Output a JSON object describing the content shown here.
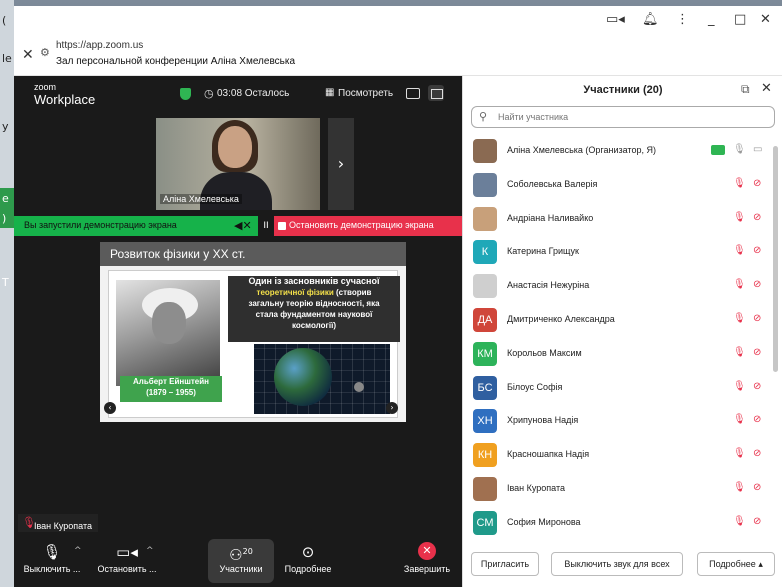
{
  "desktop": {
    "left_glyphs": [
      "(",
      "le",
      "y",
      "e",
      ")",
      "T"
    ]
  },
  "window": {
    "titlebar_icons": [
      "camera-icon",
      "bell-icon",
      "kebab-icon",
      "minimize-icon",
      "maximize-icon",
      "close-icon"
    ],
    "url": "https://app.zoom.us",
    "page_title": "Зал персональной конференции Аліна Хмелевська"
  },
  "meeting": {
    "logo_top": "zoom",
    "logo_bottom": "Workplace",
    "time_left": "03:08 Осталось",
    "view_label": "Посмотреть",
    "camera_name": "Аліна Хмелевська",
    "sharing_notice": "Вы запустили демонстрацию экрана",
    "stop_share_label": "Остановить демонстрацию экрана",
    "pause_label": "II",
    "slide": {
      "title": "Розвиток фізики у ХХ ст.",
      "fact_line1": "Один із засновників сучасної",
      "fact_highlight": "теоретичної фізики",
      "fact_line2_rest": " (створив",
      "fact_line3": "загальну теорію відносності, яка",
      "fact_line4": "стала фундаментом наукової",
      "fact_line5": "космології)",
      "caption_name": "Альберт Ейнштейн",
      "caption_years": "(1879 – 1955)"
    },
    "speaker_label": "Іван Куропата",
    "toolbar": {
      "mute_label": "Выключить ...",
      "video_label": "Остановить ...",
      "participants_label": "Участники",
      "participants_count": "20",
      "more_label": "Подробнее",
      "end_label": "Завершить"
    }
  },
  "panel": {
    "title": "Участники (20)",
    "search_placeholder": "Найти участника",
    "participants": [
      {
        "name": "Аліна Хмелевська (Организатор, Я)",
        "initials": "",
        "color": "#8a6a52",
        "host": true
      },
      {
        "name": "Соболевська Валерія",
        "initials": "",
        "color": "#6b7f9a"
      },
      {
        "name": "Андріана Наливайко",
        "initials": "",
        "color": "#c8a07a"
      },
      {
        "name": "Катерина Грищук",
        "initials": "К",
        "color": "#1fa8b8"
      },
      {
        "name": "Анастасія Нежуріна",
        "initials": "",
        "color": "#cfcfcf"
      },
      {
        "name": "Дмитриченко Александра",
        "initials": "ДА",
        "color": "#d0463a"
      },
      {
        "name": "Корольов Максим",
        "initials": "КМ",
        "color": "#2db35a"
      },
      {
        "name": "Білоус Софія",
        "initials": "БС",
        "color": "#2f5fa0"
      },
      {
        "name": "Хрипунова Надія",
        "initials": "ХН",
        "color": "#2f6fc0"
      },
      {
        "name": "Красношапка Надія",
        "initials": "КН",
        "color": "#f0a020"
      },
      {
        "name": "Іван Куропата",
        "initials": "",
        "color": "#a07050"
      },
      {
        "name": "София Миронова",
        "initials": "СМ",
        "color": "#1f9a8a"
      }
    ],
    "invite_label": "Пригласить",
    "mute_all_label": "Выключить звук для всех",
    "more_label": "Подробнее ▴"
  }
}
